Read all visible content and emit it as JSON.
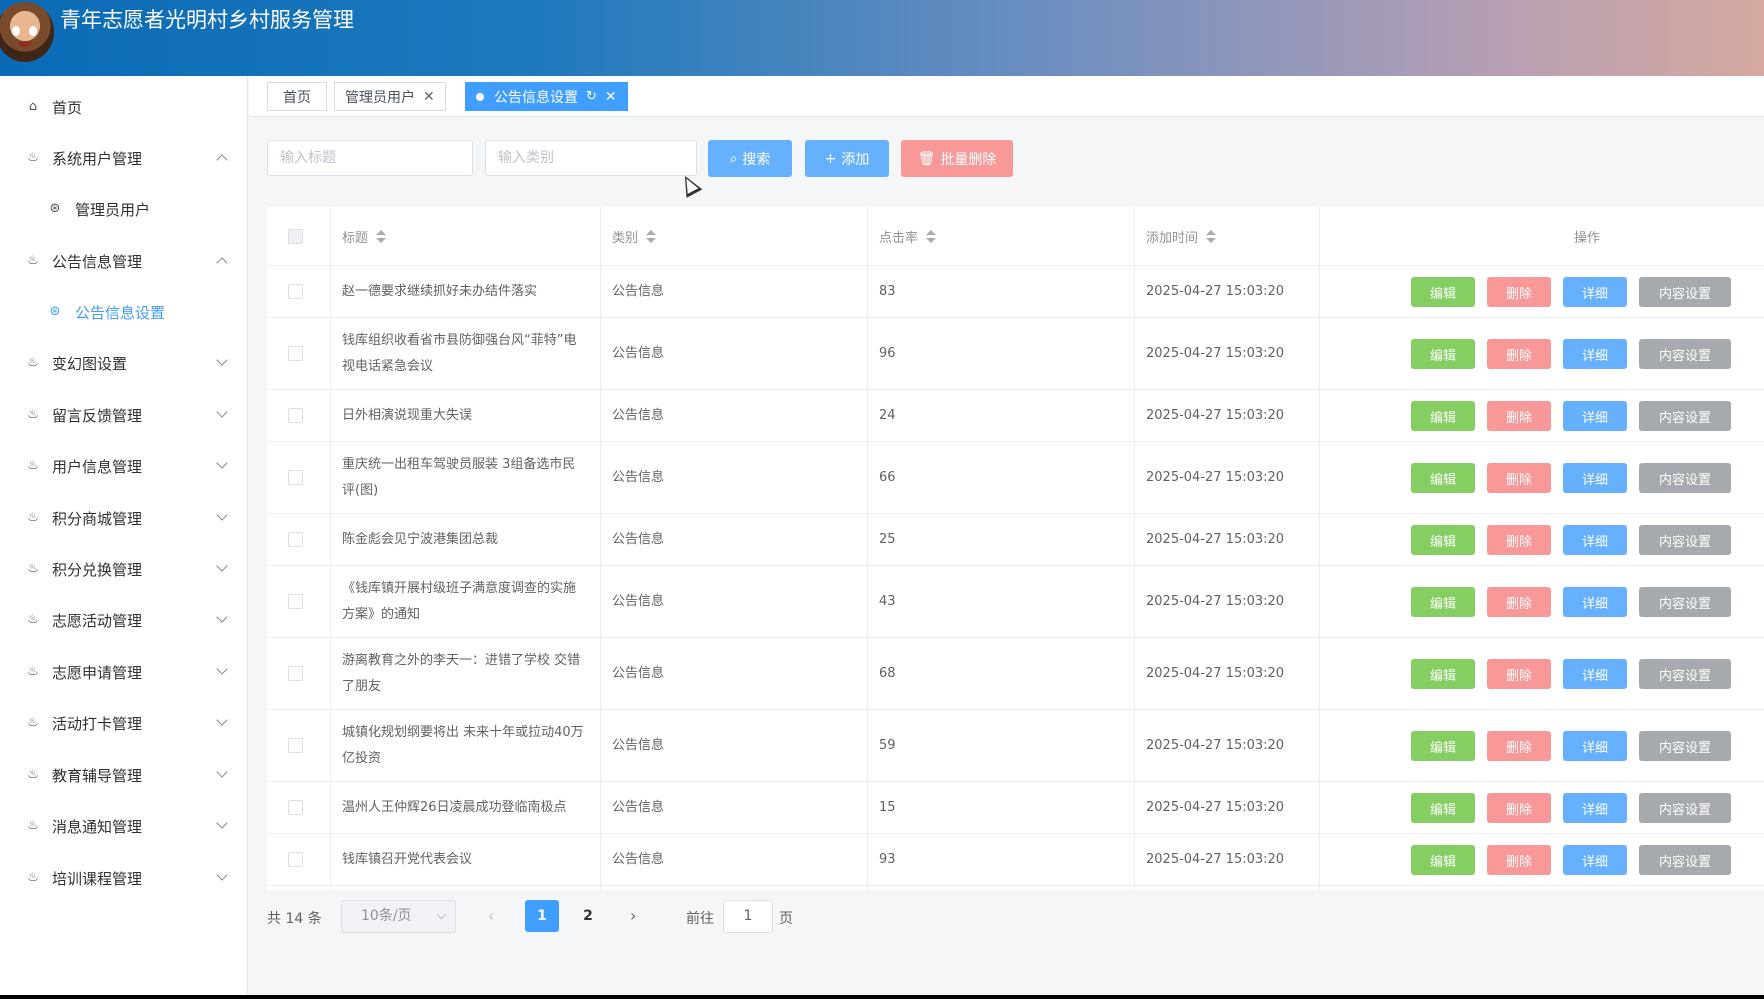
{
  "app": {
    "title": "青年志愿者光明村乡村服务管理"
  },
  "sidebar": {
    "items": [
      {
        "label": "首页",
        "icon": "home-icon"
      },
      {
        "label": "系统用户管理",
        "icon": "bowl-icon",
        "expanded": true
      },
      {
        "label": "管理员用户",
        "icon": "aperture-icon",
        "sub": true
      },
      {
        "label": "公告信息管理",
        "icon": "bowl-icon",
        "expanded": true
      },
      {
        "label": "公告信息设置",
        "icon": "aperture-icon",
        "sub": true,
        "active": true
      },
      {
        "label": "变幻图设置",
        "icon": "bowl-icon"
      },
      {
        "label": "留言反馈管理",
        "icon": "bowl-icon"
      },
      {
        "label": "用户信息管理",
        "icon": "bowl-icon"
      },
      {
        "label": "积分商城管理",
        "icon": "bowl-icon"
      },
      {
        "label": "积分兑换管理",
        "icon": "bowl-icon"
      },
      {
        "label": "志愿活动管理",
        "icon": "bowl-icon"
      },
      {
        "label": "志愿申请管理",
        "icon": "bowl-icon"
      },
      {
        "label": "活动打卡管理",
        "icon": "bowl-icon"
      },
      {
        "label": "教育辅导管理",
        "icon": "bowl-icon"
      },
      {
        "label": "消息通知管理",
        "icon": "bowl-icon"
      },
      {
        "label": "培训课程管理",
        "icon": "bowl-icon"
      }
    ]
  },
  "tabs": [
    {
      "label": "首页"
    },
    {
      "label": "管理员用户"
    },
    {
      "label": "公告信息设置",
      "active": true
    }
  ],
  "search": {
    "title_placeholder": "输入标题",
    "category_placeholder": "输入类别",
    "search_label": "搜索",
    "add_label": "添加",
    "batch_delete_label": "批量删除"
  },
  "table": {
    "headers": {
      "title": "标题",
      "category": "类别",
      "clicks": "点击率",
      "time": "添加时间",
      "ops": "操作"
    },
    "op_labels": {
      "edit": "编辑",
      "delete": "删除",
      "detail": "详细",
      "content": "内容设置"
    },
    "rows": [
      {
        "title": "赵一德要求继续抓好未办结件落实",
        "category": "公告信息",
        "clicks": "83",
        "time": "2025-04-27 15:03:20"
      },
      {
        "title": "钱库组织收看省市县防御强台风“菲特”电视电话紧急会议",
        "category": "公告信息",
        "clicks": "96",
        "time": "2025-04-27 15:03:20"
      },
      {
        "title": "日外相演说现重大失误",
        "category": "公告信息",
        "clicks": "24",
        "time": "2025-04-27 15:03:20"
      },
      {
        "title": "重庆统一出租车驾驶员服装 3组备选市民评(图)",
        "category": "公告信息",
        "clicks": "66",
        "time": "2025-04-27 15:03:20"
      },
      {
        "title": "陈金彪会见宁波港集团总裁",
        "category": "公告信息",
        "clicks": "25",
        "time": "2025-04-27 15:03:20"
      },
      {
        "title": "《钱库镇开展村级班子满意度调查的实施方案》的通知",
        "category": "公告信息",
        "clicks": "43",
        "time": "2025-04-27 15:03:20"
      },
      {
        "title": "游离教育之外的李天一：进错了学校 交错了朋友",
        "category": "公告信息",
        "clicks": "68",
        "time": "2025-04-27 15:03:20"
      },
      {
        "title": "城镇化规划纲要将出 未来十年或拉动40万亿投资",
        "category": "公告信息",
        "clicks": "59",
        "time": "2025-04-27 15:03:20"
      },
      {
        "title": "温州人王仲辉26日凌晨成功登临南极点",
        "category": "公告信息",
        "clicks": "15",
        "time": "2025-04-27 15:03:20"
      },
      {
        "title": "钱库镇召开党代表会议",
        "category": "公告信息",
        "clicks": "93",
        "time": "2025-04-27 15:03:20"
      }
    ]
  },
  "pagination": {
    "total": "共 14 条",
    "page_size": "10条/页",
    "pages": [
      "1",
      "2"
    ],
    "current": "1",
    "goto_label": "前往",
    "goto_value": "1",
    "goto_unit": "页"
  },
  "colors": {
    "primary": "#409eff",
    "success": "#85ce61",
    "danger": "#f89898",
    "info": "#a6a9ad"
  }
}
